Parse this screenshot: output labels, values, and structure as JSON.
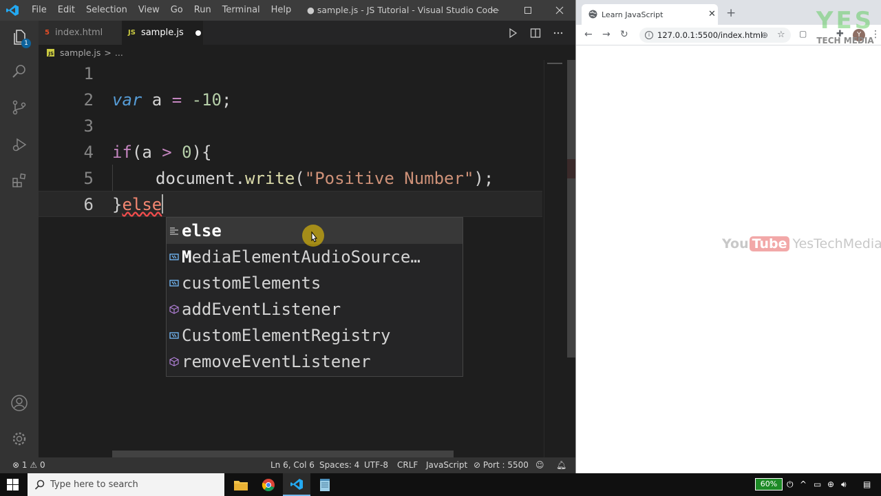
{
  "vscode": {
    "menu": [
      "File",
      "Edit",
      "Selection",
      "View",
      "Go",
      "Run",
      "Terminal",
      "Help"
    ],
    "window_title": "● sample.js - JS Tutorial - Visual Studio Code",
    "explorer_badge": "1",
    "tabs": [
      {
        "label": "index.html",
        "icon": "html5-icon",
        "active": false
      },
      {
        "label": "sample.js",
        "icon": "js-file-icon",
        "active": true,
        "dirty": true
      }
    ],
    "breadcrumb": {
      "file": "sample.js",
      "sep": ">",
      "rest": "..."
    },
    "code": {
      "line_numbers": [
        "1",
        "2",
        "3",
        "4",
        "5",
        "6"
      ],
      "current_line": "6",
      "l2": {
        "kw": "var",
        "ident": " a ",
        "op": "=",
        "num": " -10",
        "end": ";"
      },
      "l4": {
        "kw": "if",
        "open": "(a ",
        "op": ">",
        "num": " 0",
        "close": "){"
      },
      "l5": {
        "obj": "document.",
        "fn": "write",
        "open": "(",
        "str": "\"Positive Number\"",
        "close": ");"
      },
      "l6": {
        "brace": "}",
        "typed": "else"
      }
    },
    "suggestions": [
      {
        "match": "else",
        "rest": "",
        "icon": "keyword-icon",
        "selected": true
      },
      {
        "match": "M",
        "rest": "ediaElementAudioSource…",
        "icon": "variable-icon"
      },
      {
        "match": "",
        "rest": "customElements",
        "icon": "variable-icon"
      },
      {
        "match": "",
        "rest": "addEventListener",
        "icon": "method-icon"
      },
      {
        "match": "",
        "rest": "CustomElementRegistry",
        "icon": "variable-icon"
      },
      {
        "match": "",
        "rest": "removeEventListener",
        "icon": "method-icon"
      }
    ],
    "status": {
      "errors": "1",
      "warnings": "0",
      "position": "Ln 6, Col 6",
      "spaces": "Spaces: 4",
      "encoding": "UTF-8",
      "eol": "CRLF",
      "language": "JavaScript",
      "port": "Port : 5500"
    }
  },
  "browser": {
    "tab_title": "Learn JavaScript",
    "new_tab": "+",
    "url": "127.0.0.1:5500/index.html",
    "avatar_initial": "Y",
    "watermark_top": "YES",
    "watermark_bottom": "TECH MEDIA",
    "yt_you": "You",
    "yt_tube": "Tube",
    "yt_channel": "YesTechMedia"
  },
  "taskbar": {
    "search_placeholder": "Type here to search",
    "battery": "60%"
  },
  "colors": {
    "accent": "#007acc",
    "keyword": "#569cd6",
    "control": "#c586c0",
    "function": "#dcdcaa",
    "string": "#ce9178",
    "number": "#b5cea8",
    "error": "#f48771"
  }
}
